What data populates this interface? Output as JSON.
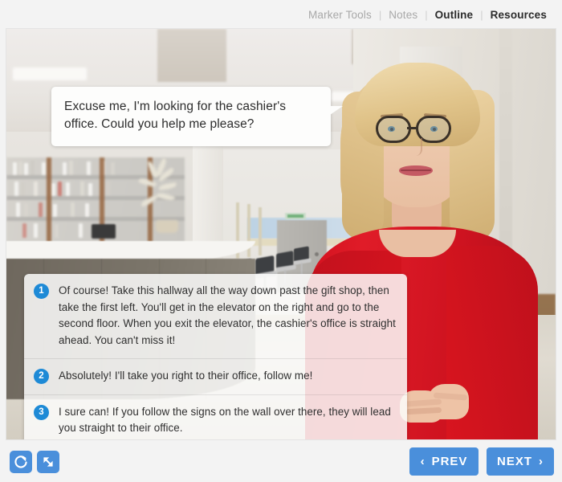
{
  "header": {
    "tabs": [
      {
        "label": "Marker Tools",
        "active": false
      },
      {
        "label": "Notes",
        "active": false
      },
      {
        "label": "Outline",
        "active": true
      },
      {
        "label": "Resources",
        "active": true
      }
    ],
    "separator": "|"
  },
  "scene": {
    "description": "clinic-lobby-reception",
    "character": "woman-in-red-dress-with-glasses"
  },
  "bubble": {
    "text": "Excuse me, I'm looking for the cashier's office. Could you help me please?"
  },
  "answers": [
    {
      "number": "1",
      "text": "Of course! Take this hallway all the way down past the gift shop, then take the first left. You'll get in the elevator  on the right and go to the second floor. When you exit the elevator, the cashier's office is straight ahead. You can't miss it!"
    },
    {
      "number": "2",
      "text": "Absolutely! I'll take you right to their office, follow me!"
    },
    {
      "number": "3",
      "text": "I sure can! If you follow the signs on the wall over there, they will lead you straight to their office."
    }
  ],
  "footer": {
    "replay_icon": "replay-icon",
    "expand_icon": "fullscreen-expand-icon",
    "prev_label": "PREV",
    "next_label": "NEXT",
    "prev_chevron": "‹",
    "next_chevron": "›"
  },
  "colors": {
    "accent_blue": "#4a8fdb",
    "badge_blue": "#1e8ad6",
    "page_bg": "#f3f3f3",
    "dress_red": "#d3121f",
    "active_tab": "#2b2b2b",
    "inactive_tab": "#a8a8a8"
  }
}
